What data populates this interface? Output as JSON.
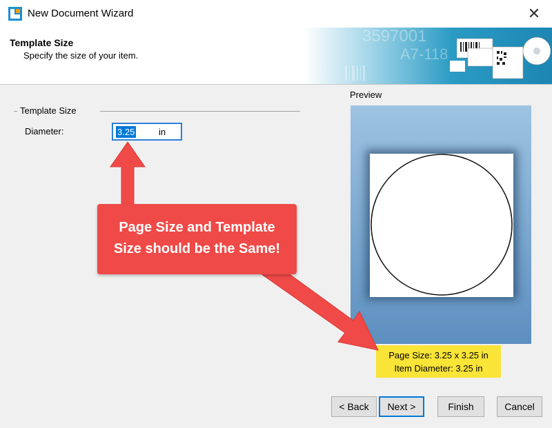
{
  "window": {
    "title": "New Document Wizard"
  },
  "header": {
    "title": "Template Size",
    "subtitle": "Specify the size of your item.",
    "banner_text_1": "3597001",
    "banner_text_2": "A7-118"
  },
  "group": {
    "label": "Template Size"
  },
  "diameter": {
    "label": "Diameter:",
    "value": "3.25",
    "unit": "in"
  },
  "preview": {
    "label": "Preview"
  },
  "info": {
    "page_size": "Page Size:  3.25 x 3.25 in",
    "item_diameter": "Item Diameter:  3.25 in"
  },
  "callout": {
    "line1": "Page Size and Template",
    "line2": "Size should be the Same!"
  },
  "buttons": {
    "back": "< Back",
    "next": "Next >",
    "finish": "Finish",
    "cancel": "Cancel"
  },
  "colors": {
    "accent": "#0078d7",
    "callout": "#ef4a47",
    "highlight": "#f9e437",
    "preview_bg": "#7ea9cf"
  },
  "icons": {
    "app": "app-logo-icon",
    "close": "close-icon"
  }
}
